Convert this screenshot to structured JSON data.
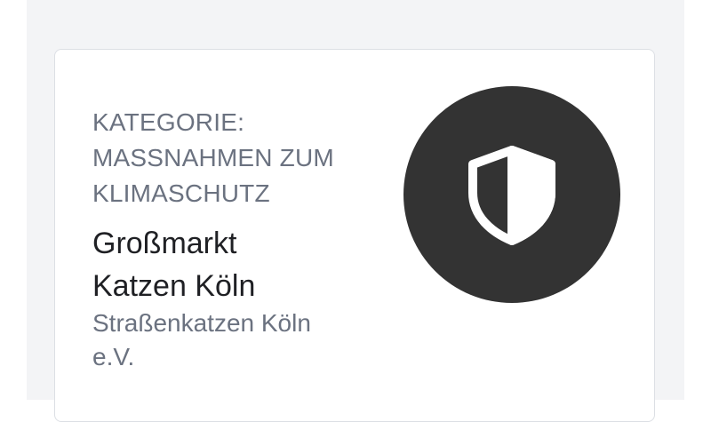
{
  "card": {
    "category_lines": [
      "KATEGORIE:",
      "MASSNAHMEN ZUM",
      "KLIMASCHUTZ"
    ],
    "title_lines": [
      "Großmarkt",
      "Katzen Köln"
    ],
    "organization_lines": [
      "Straßenkatzen Köln",
      "e.V."
    ],
    "badge_icon": "shield-icon",
    "colors": {
      "badge_background": "#333333",
      "icon": "#ffffff",
      "muted_text": "#6b7280",
      "title_text": "#1f2024"
    }
  }
}
